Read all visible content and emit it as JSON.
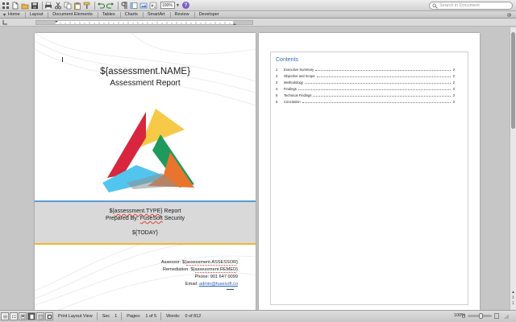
{
  "search": {
    "placeholder": "Search in Document"
  },
  "toolbar": {
    "zoom_value": "100%"
  },
  "ribbon": {
    "tabs": [
      "Home",
      "Layout",
      "Document Elements",
      "Tables",
      "Charts",
      "SmartArt",
      "Review",
      "Developer"
    ]
  },
  "page1": {
    "title_var": "${assessment.NAME}",
    "subtitle": "Assessment Report",
    "type_prefix": "${",
    "type_var": "assessment.TYPE",
    "type_suffix": "} Report",
    "prepared_prefix": "Prepared By: ",
    "prepared_company": "FuseSoft",
    "prepared_suffix": " Security",
    "date_var": "${TODAY}",
    "assessor_label": "Assessor: ${",
    "assessor_var": "assessment.ASSESSOR",
    "assessor_suffix": "}",
    "remediation_label": "Remediation: ${",
    "remediation_var": "assessment.REMED",
    "remediation_suffix": "}",
    "phone_line": "Phone: 901 647 0099",
    "email_label": "Email: ",
    "email_value": "admin@fusesoft.co",
    "colors": {
      "band_top": "#5b9bd5",
      "band_bottom": "#f5b330",
      "band_fill": "#d9d9d9"
    }
  },
  "page2": {
    "toc_title": "Contents",
    "toc_items": [
      {
        "num": "1",
        "label": "Executive Summary",
        "page": "2"
      },
      {
        "num": "2",
        "label": "Objective and Scope",
        "page": "2"
      },
      {
        "num": "3",
        "label": "Methodology",
        "page": "2"
      },
      {
        "num": "4",
        "label": "Findings",
        "page": "3"
      },
      {
        "num": "5",
        "label": "Technical Findings",
        "page": "3"
      },
      {
        "num": "6",
        "label": "Conclusion",
        "page": "3"
      }
    ]
  },
  "status": {
    "view_name": "Print Layout View",
    "sec_label": "Sec",
    "sec_value": "1",
    "pages_label": "Pages:",
    "pages_value": "1 of 5",
    "words_label": "Words:",
    "words_value": "0 of 812",
    "zoom": "100%"
  },
  "icons": [
    "apps-icon",
    "new-doc-icon",
    "open-icon",
    "save-icon",
    "print-icon",
    "cut-icon",
    "copy-icon",
    "paste-icon",
    "format-painter-icon",
    "undo-icon",
    "redo-icon",
    "paragraph-icon",
    "sidebar-icon",
    "gallery-icon",
    "media-icon",
    "help-icon",
    "search-icon"
  ]
}
